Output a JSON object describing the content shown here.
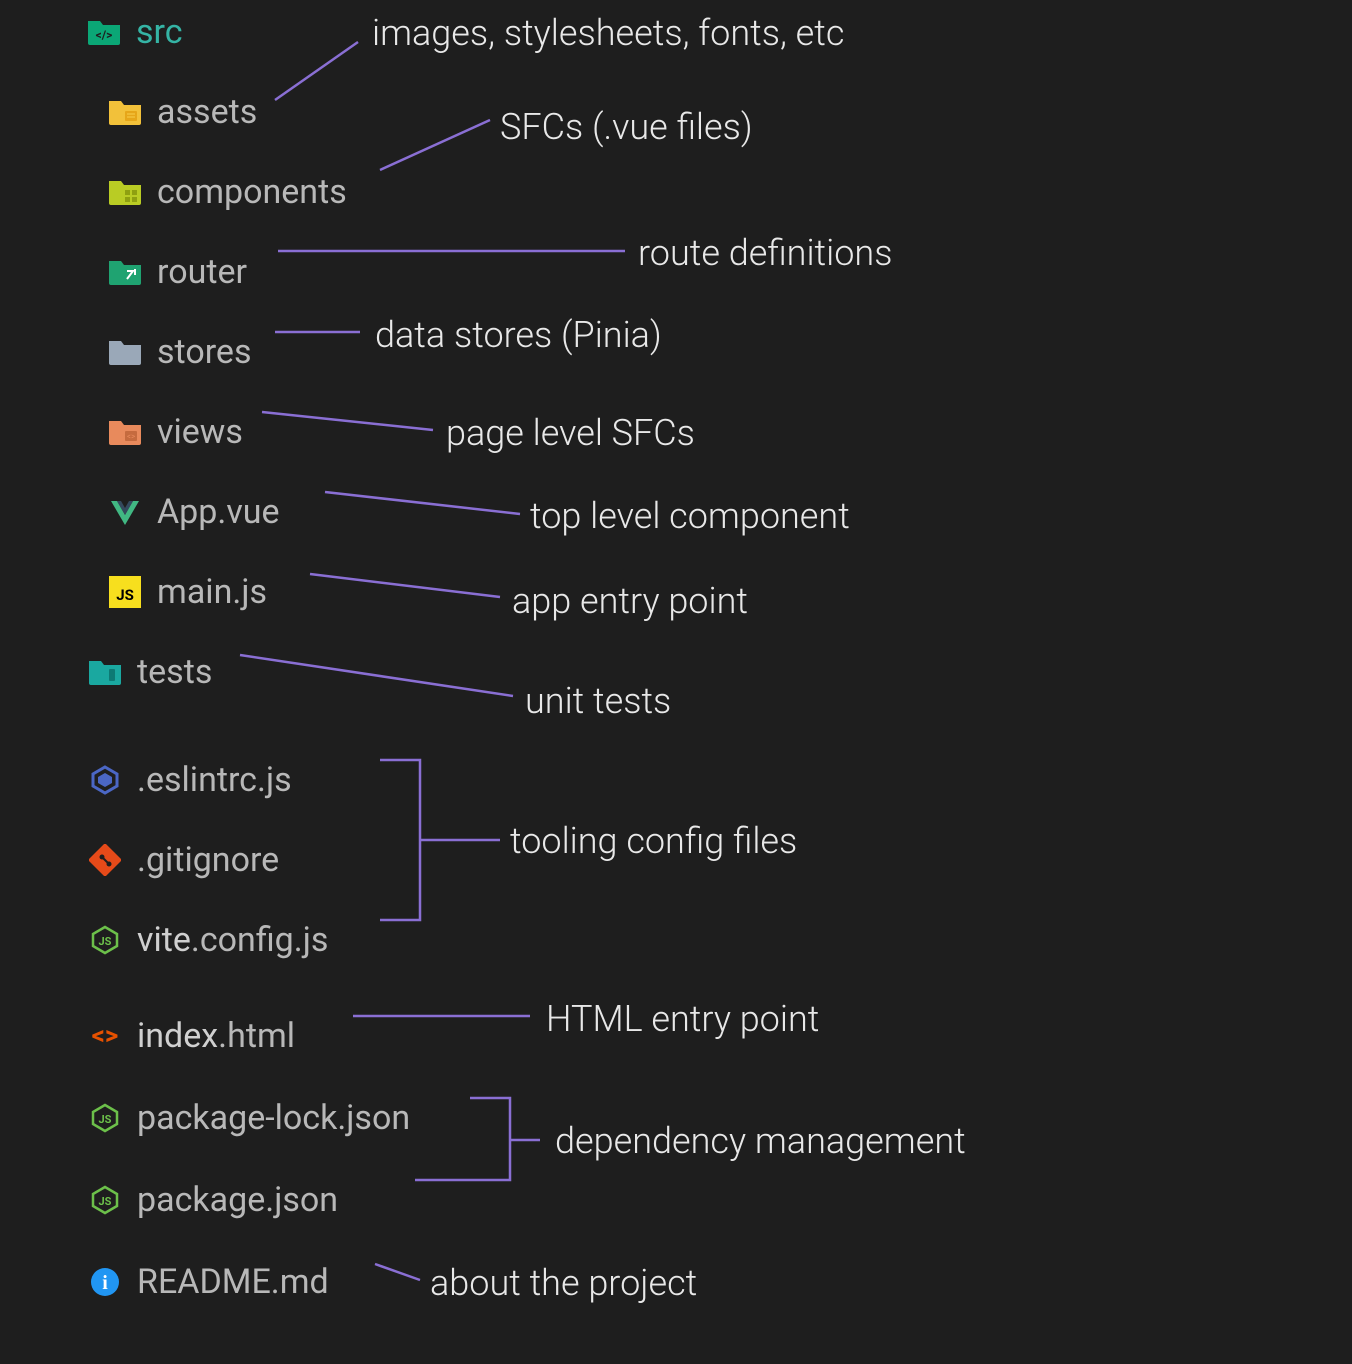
{
  "tree": {
    "src": {
      "label": "src"
    },
    "assets": {
      "label": "assets"
    },
    "components": {
      "label": "components"
    },
    "router": {
      "label": "router"
    },
    "stores": {
      "label": "stores"
    },
    "views": {
      "label": "views"
    },
    "appvue": {
      "label": "App.vue"
    },
    "mainjs": {
      "label": "main.js"
    },
    "tests": {
      "label": "tests"
    },
    "eslintrc": {
      "label": ".eslintrc.js"
    },
    "gitignore": {
      "label": ".gitignore"
    },
    "viteconfig": {
      "label_a": "vite",
      "label_b": ".config.js"
    },
    "indexhtml": {
      "label_a": "index",
      "label_b": ".html"
    },
    "packagelock": {
      "label": "package-lock.json"
    },
    "packagejson": {
      "label": "package.json"
    },
    "readme": {
      "label": "README.md"
    }
  },
  "annotations": {
    "assets": "images, stylesheets, fonts, etc",
    "components": "SFCs (.vue files)",
    "router": "route definitions",
    "stores": "data stores (Pinia)",
    "views": "page level SFCs",
    "appvue": "top level component",
    "mainjs": "app entry point",
    "tests": "unit tests",
    "tooling": "tooling config files",
    "indexhtml": "HTML entry point",
    "dependency": "dependency management",
    "readme": "about the project"
  },
  "colors": {
    "connector": "#8a6fd4",
    "bg": "#1e1e1e"
  }
}
